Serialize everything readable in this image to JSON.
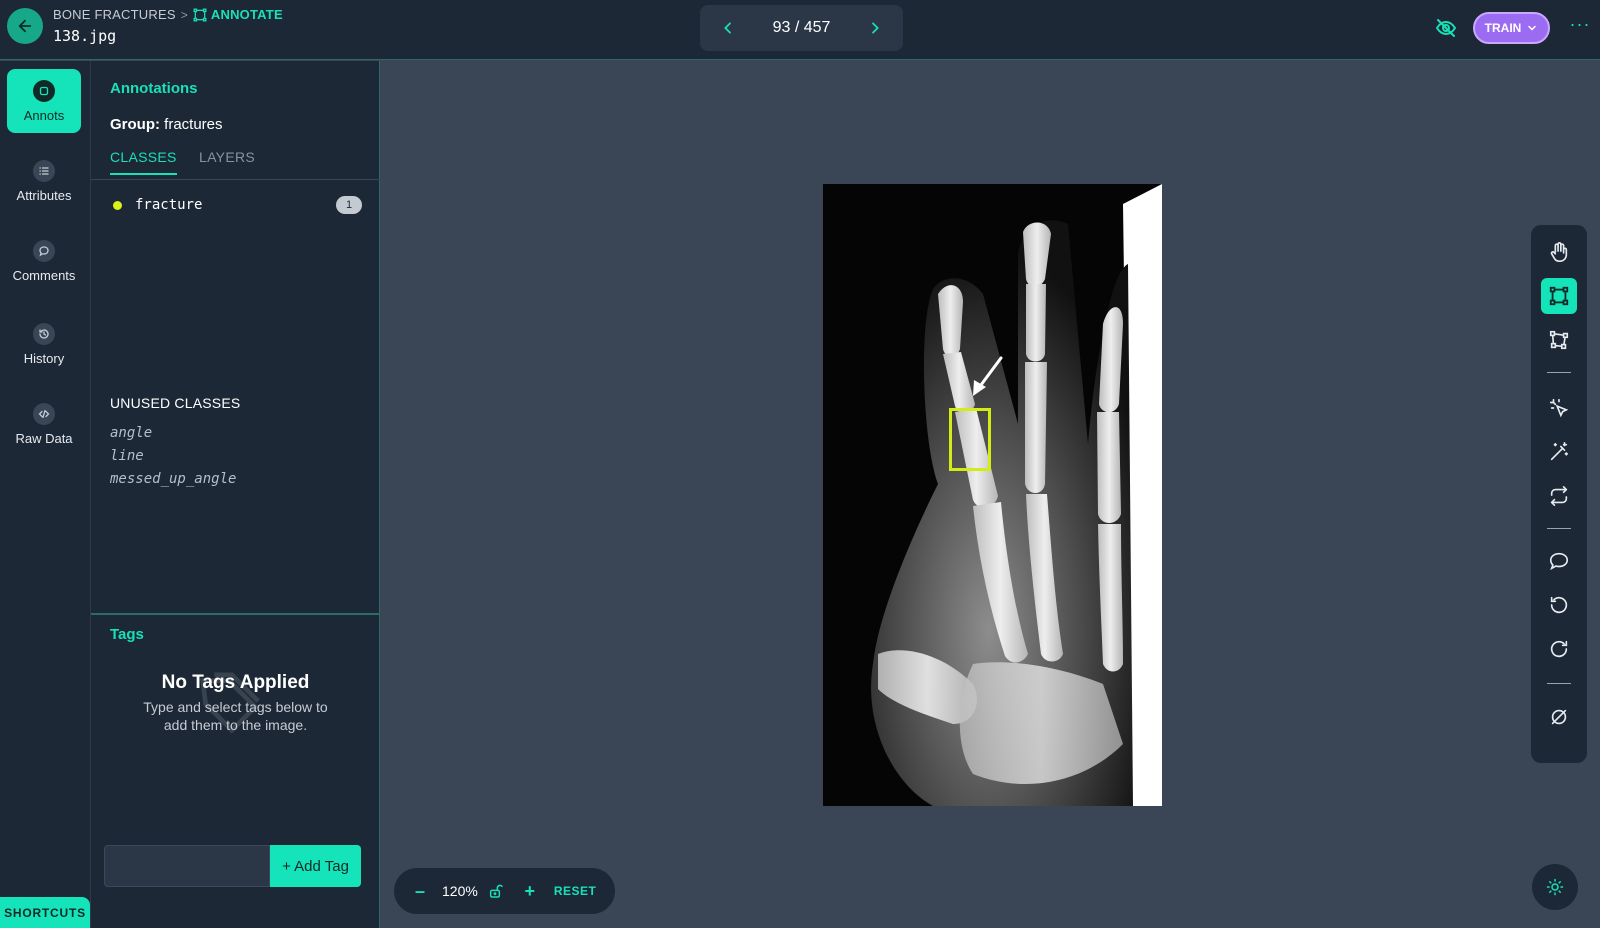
{
  "header": {
    "breadcrumb_project": "BONE FRACTURES",
    "breadcrumb_separator": ">",
    "breadcrumb_current": "ANNOTATE",
    "filename": "138.jpg",
    "pager": "93 / 457",
    "train_label": "TRAIN",
    "more_label": "···"
  },
  "nav": {
    "items": [
      {
        "label": "Annots",
        "icon": "annotations-icon"
      },
      {
        "label": "Attributes",
        "icon": "list-icon"
      },
      {
        "label": "Comments",
        "icon": "comment-icon"
      },
      {
        "label": "History",
        "icon": "history-icon"
      },
      {
        "label": "Raw Data",
        "icon": "code-icon"
      }
    ],
    "shortcuts_label": "SHORTCUTS"
  },
  "panel": {
    "title": "Annotations",
    "group_label": "Group:",
    "group_value": "fractures",
    "tabs": [
      {
        "label": "CLASSES"
      },
      {
        "label": "LAYERS"
      }
    ],
    "classes": [
      {
        "name": "fracture",
        "count": "1",
        "color": "#d8f21a"
      }
    ],
    "unused_heading": "UNUSED CLASSES",
    "unused": [
      "angle",
      "line",
      "messed_up_angle"
    ]
  },
  "tags": {
    "title": "Tags",
    "empty_title": "No Tags Applied",
    "empty_sub_1": "Type and select tags below to",
    "empty_sub_2": "add them to the image.",
    "input_value": "",
    "add_label": "+ Add Tag"
  },
  "zoom": {
    "level": "120%",
    "minus": "–",
    "plus": "+",
    "reset_label": "RESET"
  },
  "toolbar": {
    "tools": [
      "hand-icon",
      "bounding-box-icon",
      "polygon-icon",
      "smart-select-icon",
      "magic-wand-icon",
      "repeat-icon",
      "comment-icon",
      "undo-icon",
      "redo-icon",
      "null-icon"
    ],
    "active_tool": "bounding-box-icon"
  },
  "colors": {
    "accent": "#15e3ba",
    "train": "#9b6cf2",
    "annotation_box": "#d3ec14"
  }
}
